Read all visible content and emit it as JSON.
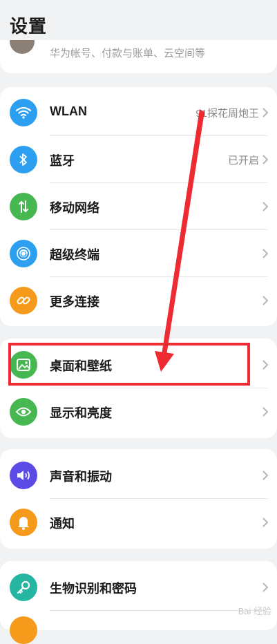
{
  "header": {
    "title": "设置"
  },
  "account": {
    "subtitle": "华为帐号、付款与账单、云空间等"
  },
  "groups": [
    {
      "items": [
        {
          "label": "WLAN",
          "value": "91探花周炮王",
          "icon": "wifi-icon",
          "color": "#2d9ff0"
        },
        {
          "label": "蓝牙",
          "value": "已开启",
          "icon": "bluetooth-icon",
          "color": "#2d9ff0"
        },
        {
          "label": "移动网络",
          "value": "",
          "icon": "mobile-network-icon",
          "color": "#46b751"
        },
        {
          "label": "超级终端",
          "value": "",
          "icon": "super-device-icon",
          "color": "#2d9ff0"
        },
        {
          "label": "更多连接",
          "value": "",
          "icon": "link-icon",
          "color": "#f59a1b"
        }
      ]
    },
    {
      "items": [
        {
          "label": "桌面和壁纸",
          "value": "",
          "icon": "wallpaper-icon",
          "color": "#46b751"
        },
        {
          "label": "显示和亮度",
          "value": "",
          "icon": "eye-icon",
          "color": "#46b751"
        }
      ]
    },
    {
      "items": [
        {
          "label": "声音和振动",
          "value": "",
          "icon": "speaker-icon",
          "color": "#5b4ce8"
        },
        {
          "label": "通知",
          "value": "",
          "icon": "bell-icon",
          "color": "#f59a1b"
        }
      ]
    },
    {
      "items": [
        {
          "label": "生物识别和密码",
          "value": "",
          "icon": "key-icon",
          "color": "#26b5a0"
        }
      ]
    }
  ],
  "annotation": {
    "color": "#ee2a33"
  },
  "watermark": "Bai 经验"
}
